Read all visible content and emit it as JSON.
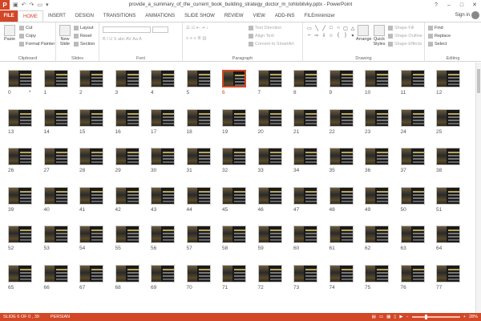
{
  "window": {
    "title": "provide_a_summary_of_the_current_book_building_strategy_doctor_m_tohlobitvky.pptx - PowerPoint",
    "app_logo": "P",
    "controls": [
      "?",
      "–",
      "□",
      "✕"
    ]
  },
  "tabs": [
    "FILE",
    "HOME",
    "INSERT",
    "DESIGN",
    "TRANSITIONS",
    "ANIMATIONS",
    "SLIDE SHOW",
    "REVIEW",
    "VIEW",
    "ADD-INS",
    "FILEminimizer"
  ],
  "active_tab": "HOME",
  "signin": "Sign in",
  "ribbon": {
    "clipboard": {
      "paste": "Paste",
      "cut": "Cut",
      "copy": "Copy",
      "format_painter": "Format Painter",
      "label": "Clipboard"
    },
    "slides": {
      "new_slide": "New Slide",
      "layout": "Layout",
      "reset": "Reset",
      "section": "Section",
      "label": "Slides"
    },
    "font": {
      "label": "Font"
    },
    "paragraph": {
      "text_direction": "Text Direction",
      "align_text": "Align Text",
      "convert": "Convert to SmartArt",
      "label": "Paragraph"
    },
    "drawing": {
      "arrange": "Arrange",
      "quick_styles": "Quick Styles",
      "shape_fill": "Shape Fill",
      "shape_outline": "Shape Outline",
      "shape_effects": "Shape Effects",
      "label": "Drawing"
    },
    "editing": {
      "find": "Find",
      "replace": "Replace",
      "select": "Select",
      "label": "Editing"
    }
  },
  "slides": {
    "selected": "6",
    "numbers": [
      "0",
      "1",
      "2",
      "3",
      "4",
      "5",
      "6",
      "7",
      "8",
      "9",
      "10",
      "11",
      "12",
      "13",
      "14",
      "15",
      "16",
      "17",
      "18",
      "19",
      "20",
      "21",
      "22",
      "23",
      "24",
      "25",
      "26",
      "27",
      "28",
      "29",
      "30",
      "31",
      "32",
      "33",
      "34",
      "35",
      "36",
      "37",
      "38",
      "39",
      "40",
      "41",
      "42",
      "43",
      "44",
      "45",
      "46",
      "47",
      "48",
      "49",
      "50",
      "51",
      "52",
      "53",
      "54",
      "55",
      "56",
      "57",
      "58",
      "59",
      "60",
      "61",
      "62",
      "63",
      "64",
      "65",
      "66",
      "67",
      "68",
      "69",
      "70",
      "71",
      "72",
      "73",
      "74",
      "75",
      "76",
      "77"
    ],
    "light_slides": [],
    "star_on_slide": "0"
  },
  "status": {
    "slide_info": "SLIDE 6 OF 0 , 39",
    "language": "PERSIAN",
    "zoom": "28%",
    "zoom_level": 0.28
  },
  "colors": {
    "accent": "#d24726"
  }
}
